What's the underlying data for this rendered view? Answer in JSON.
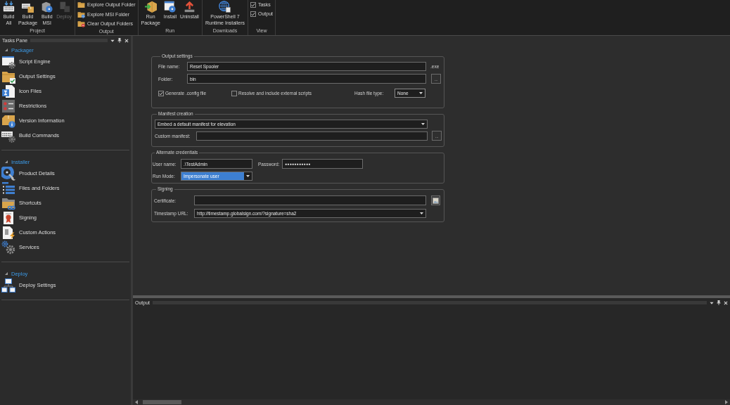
{
  "ribbon": {
    "groups": [
      {
        "label": "Project",
        "kind": "large",
        "items": [
          {
            "label": "Build\nAll",
            "disabled": false
          },
          {
            "label": "Build\nPackage",
            "disabled": false
          },
          {
            "label": "Build\nMSI",
            "disabled": false
          },
          {
            "label": "Deploy",
            "disabled": true
          }
        ]
      },
      {
        "label": "Output",
        "kind": "small",
        "items": [
          {
            "label": "Explore Output Folder"
          },
          {
            "label": "Explore MSI Folder"
          },
          {
            "label": "Clear Output Folders"
          }
        ]
      },
      {
        "label": "Run",
        "kind": "large",
        "items": [
          {
            "label": "Run\nPackage",
            "disabled": false
          },
          {
            "label": "Install",
            "disabled": false
          },
          {
            "label": "Uninstall",
            "disabled": false
          }
        ]
      },
      {
        "label": "Downloads",
        "kind": "large",
        "items": [
          {
            "label": "PowerShell 7\nRuntime Installers",
            "disabled": false
          }
        ]
      },
      {
        "label": "View",
        "kind": "checks",
        "items": [
          {
            "label": "Tasks",
            "checked": true
          },
          {
            "label": "Output",
            "checked": true
          }
        ]
      }
    ]
  },
  "tasks_pane": {
    "title": "Tasks Pane",
    "sections": [
      {
        "title": "Packager",
        "expanded": true,
        "items": [
          "Script Engine",
          "Output Settings",
          "Icon Files",
          "Restrictions",
          "Version Information",
          "Build Commands"
        ]
      },
      {
        "title": "Installer",
        "expanded": true,
        "items": [
          "Product Details",
          "Files and Folders",
          "Shortcuts",
          "Signing",
          "Custom Actions",
          "Services"
        ]
      },
      {
        "title": "Deploy",
        "expanded": true,
        "items": [
          "Deploy Settings"
        ]
      }
    ]
  },
  "output_settings": {
    "title": "Output settings",
    "file_name": {
      "label": "File name:",
      "value": "Reset Spooler",
      "extension": ".exe"
    },
    "folder": {
      "label": "Folder:",
      "value": "bin",
      "browse": "..."
    },
    "options": [
      {
        "label": "Generate .config file",
        "checked": true
      },
      {
        "label": "Resolve and include external scripts",
        "checked": false
      }
    ],
    "hash_file_type": {
      "label": "Hash file type:",
      "value": "None"
    }
  },
  "manifest_creation": {
    "title": "Manifest creation",
    "mode": "Embed a default manifest for elevation",
    "custom_manifest": {
      "label": "Custom manifest:",
      "browse": "..."
    }
  },
  "alternate_credentials": {
    "title": "Alternate credentials",
    "user_name": {
      "label": "User name:",
      "value": ".\\TestAdmin"
    },
    "password": {
      "label": "Password:",
      "value": "●●●●●●●●●●●"
    },
    "run_mode": {
      "label": "Run Mode:",
      "value": "Impersonate user",
      "focused": true
    }
  },
  "signing": {
    "title": "Signing",
    "certificate": {
      "label": "Certificate:"
    },
    "timestamp_url": {
      "label": "Timestamp URL:",
      "value": "http://timestamp.globalsign.com/?signature=sha2"
    }
  },
  "output_pane": {
    "title": "Output"
  }
}
